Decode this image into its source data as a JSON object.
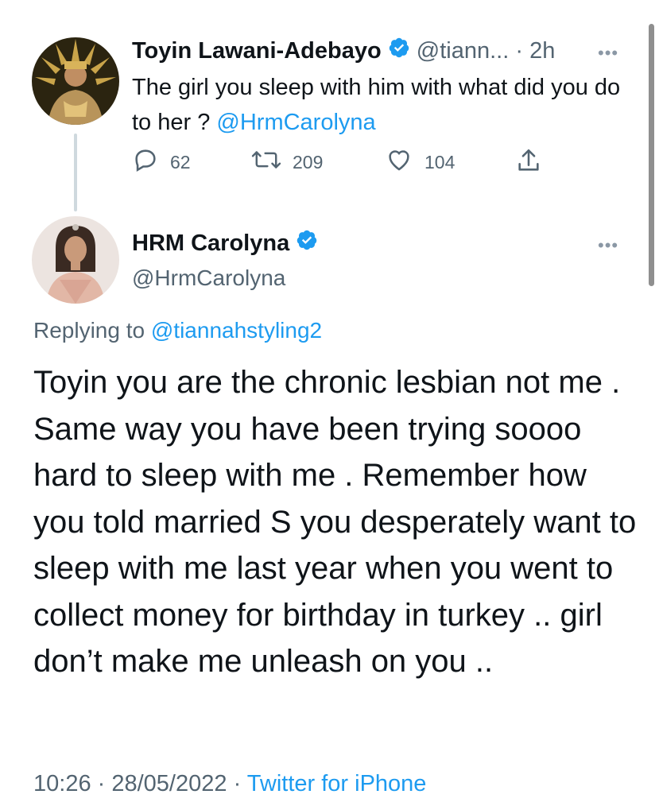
{
  "tweet1": {
    "author_name": "Toyin Lawani-Adebayo",
    "handle": "@tiann...",
    "separator": "·",
    "time": "2h",
    "text_part": "The girl you sleep with him with what did you do to her ? ",
    "mention": "@HrmCarolyna",
    "stats": {
      "replies": "62",
      "retweets": "209",
      "likes": "104"
    },
    "more_icon": "•••"
  },
  "tweet2": {
    "author_name": "HRM Carolyna",
    "handle": "@HrmCarolyna",
    "more_icon": "•••",
    "replying_prefix": "Replying to ",
    "replying_to": "@tiannahstyling2",
    "body": "Toyin you are the chronic lesbian not me . Same way you have been trying soooo hard to sleep with me . Remember how you told married S you desperately want to sleep with me last year when you went to collect money for birthday in turkey .. girl don’t make me unleash on you ..",
    "time": "10:26",
    "date": "28/05/2022",
    "source": "Twitter for iPhone",
    "separator": " · "
  },
  "colors": {
    "accent": "#1d9bf0",
    "secondary_text": "#536471",
    "primary_text": "#0f1419",
    "verified": "#1d9bf0"
  }
}
